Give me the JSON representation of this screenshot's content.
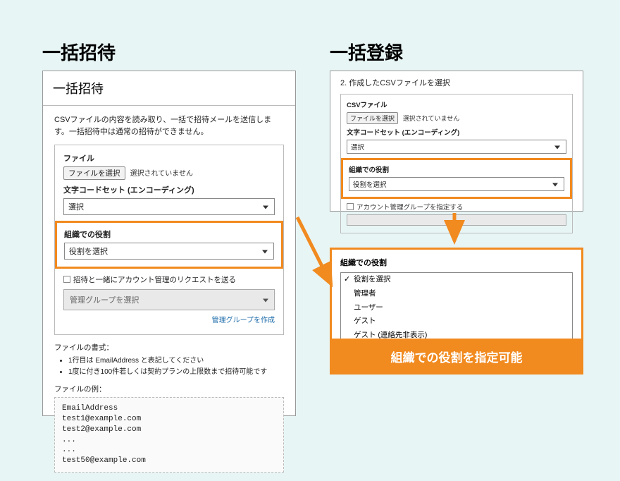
{
  "headings": {
    "left": "一括招待",
    "right": "一括登録"
  },
  "left_panel": {
    "title": "一括招待",
    "description": "CSVファイルの内容を読み取り、一括で招待メールを送信します。一括招待中は通常の招待ができません。",
    "file_label": "ファイル",
    "file_select_btn": "ファイルを選択",
    "no_file_text": "選択されていません",
    "encoding_label": "文字コードセット (エンコーディング)",
    "encoding_select_placeholder": "選択",
    "role_label": "組織での役割",
    "role_select_placeholder": "役割を選択",
    "checkbox_text": "招待と一緒にアカウント管理のリクエストを送る",
    "group_select_placeholder": "管理グループを選択",
    "create_group_link": "管理グループを作成",
    "file_format_label": "ファイルの書式：",
    "bullets": [
      "1行目は EmailAddress と表記してください",
      "1度に付き100件若しくは契約プランの上限数まで招待可能です"
    ],
    "file_example_label": "ファイルの例：",
    "code_lines": "EmailAddress\ntest1@example.com\ntest2@example.com\n...\n...\ntest50@example.com"
  },
  "right_panel": {
    "step_title": "2. 作成したCSVファイルを選択",
    "file_label": "CSVファイル",
    "file_select_btn": "ファイルを選択",
    "no_file_text": "選択されていません",
    "encoding_label": "文字コードセット (エンコーディング)",
    "encoding_select_placeholder": "選択",
    "role_label": "組織での役割",
    "role_select_placeholder": "役割を選択",
    "checkbox_text": "アカウント管理グループを指定する"
  },
  "dropdown": {
    "title": "組織での役割",
    "options": [
      "役割を選択",
      "管理者",
      "ユーザー",
      "ゲスト",
      "ゲスト (連絡先非表示)"
    ],
    "selected_index": 0
  },
  "caption": "組織での役割を指定可能",
  "colors": {
    "accent": "#f18a1f",
    "bg": "#e8f5f5"
  }
}
